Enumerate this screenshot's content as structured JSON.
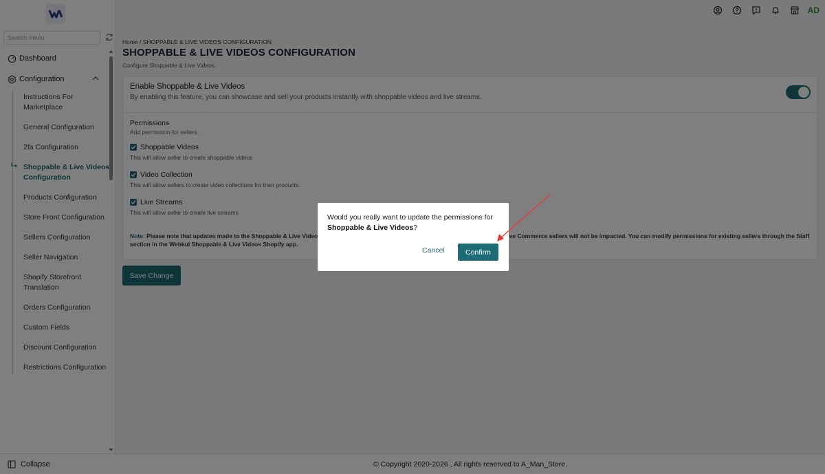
{
  "sidebar": {
    "search_placeholder": "Search menu",
    "dashboard_label": "Dashboard",
    "configuration_label": "Configuration",
    "sub_items": [
      {
        "label": "Instructions For Marketplace"
      },
      {
        "label": "General Configuration"
      },
      {
        "label": "2fa Configuration"
      },
      {
        "label": "Shoppable & Live Videos Configuration",
        "active": true
      },
      {
        "label": "Products Configuration"
      },
      {
        "label": "Store Front Configuration"
      },
      {
        "label": "Sellers Configuration"
      },
      {
        "label": "Seller Navigation"
      },
      {
        "label": "Shopify Storefront Translation"
      },
      {
        "label": "Orders Configuration"
      },
      {
        "label": "Custom Fields"
      },
      {
        "label": "Discount Configuration"
      },
      {
        "label": "Restrictions Configuration"
      }
    ],
    "collapse_label": "Collapse"
  },
  "header": {
    "icons": [
      "user-circle-icon",
      "help-icon",
      "feedback-icon",
      "bell-icon",
      "store-icon"
    ],
    "avatar_initials": "AD"
  },
  "main": {
    "breadcrumb_home": "Home",
    "breadcrumb_sep": " / ",
    "breadcrumb_current": "SHOPPABLE & LIVE VIDEOS CONFIGURATION",
    "title": "SHOPPABLE & LIVE VIDEOS CONFIGURATION",
    "subtitle": "Configure Shoppable & Live Videos.",
    "enable_title": "Enable Shoppable & Live Videos",
    "enable_desc": "By enabling this feature, you can showcase and sell your products instantly with shoppable videos and live streams.",
    "toggle_on": true,
    "permissions_title": "Permissions",
    "permissions_sub": "Add permission for sellers.",
    "permissions": [
      {
        "label": "Shoppable Videos",
        "desc": "This will allow seller to create shoppable videos",
        "checked": true
      },
      {
        "label": "Video Collection",
        "desc": "This will allow sellers to create video collections for their products.",
        "checked": true
      },
      {
        "label": "Live Streams",
        "desc": "This will allow seller to create live streams",
        "checked": true
      }
    ],
    "note_label": "Note:",
    "note_text": " Please note that updates made to the Shoppable & Live Videos permissions will only apply to new sellers. Existing Shoppable & Live Commerce sellers will not be impacted. You can modify permissions for existing sellers through the Staff section in the Webkul Shoppable & Live Videos Shopify app.",
    "save_label": "Save Change"
  },
  "footer": {
    "copyright": "© Copyright 2020-2026 , All rights reserved to A_Man_Store."
  },
  "dialog": {
    "message_prefix": "Would you really want to update the permissions for ",
    "message_bold": "Shoppable & Live Videos",
    "message_suffix": "?",
    "cancel_label": "Cancel",
    "confirm_label": "Confirm"
  },
  "colors": {
    "accent": "#1d6b74",
    "avatar": "#2d8b3a",
    "annotation_arrow": "#e53935"
  }
}
